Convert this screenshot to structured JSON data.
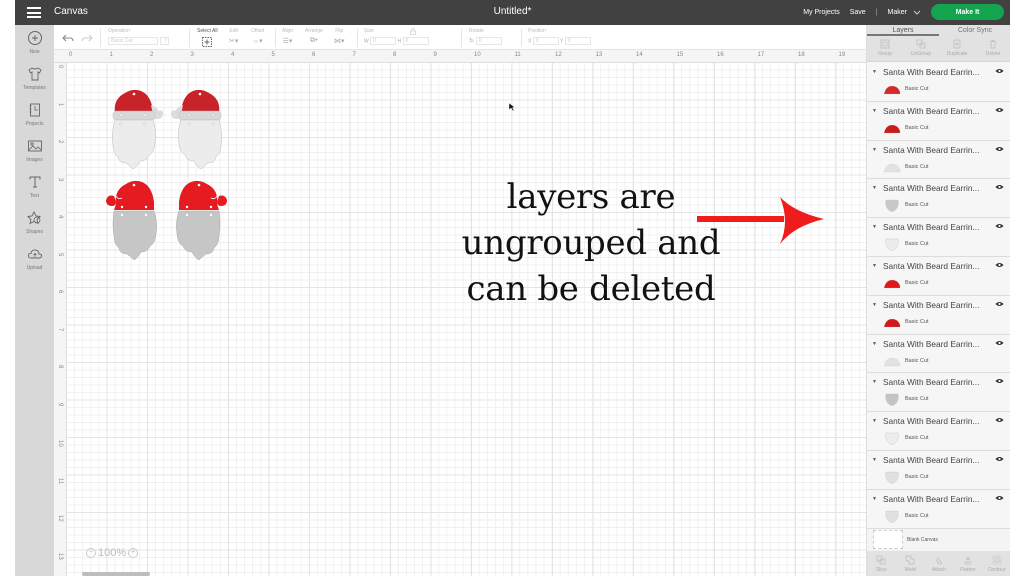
{
  "header": {
    "app_title": "Canvas",
    "document_title": "Untitled*",
    "links": [
      "My Projects",
      "Save"
    ],
    "machine": "Maker",
    "make_it": "Make It",
    "accent": "#14a44d"
  },
  "leftnav": {
    "items": [
      {
        "label": "New",
        "icon": "plus-circle-icon"
      },
      {
        "label": "Templates",
        "icon": "tshirt-icon"
      },
      {
        "label": "Projects",
        "icon": "notebook-icon"
      },
      {
        "label": "Images",
        "icon": "image-icon"
      },
      {
        "label": "Text",
        "icon": "text-icon"
      },
      {
        "label": "Shapes",
        "icon": "shapes-icon"
      },
      {
        "label": "Upload",
        "icon": "cloud-upload-icon"
      }
    ]
  },
  "toolbar": {
    "operation_label": "Operation",
    "operation_value": "Basic Cut",
    "help": "?",
    "select_all": "Select All",
    "edit": "Edit",
    "offset": "Offset",
    "align": "Align",
    "arrange": "Arrange",
    "flip": "Flip",
    "size": "Size",
    "w_label": "W",
    "h_label": "H",
    "rotate": "Rotate",
    "position": "Position",
    "x_label": "X",
    "y_label": "Y",
    "w_value": "0",
    "h_value": "0",
    "rotate_value": "0",
    "x_value": "0",
    "y_value": "0"
  },
  "rulers": {
    "horizontal": [
      "0",
      "1",
      "2",
      "3",
      "4",
      "5",
      "6",
      "7",
      "8",
      "9",
      "10",
      "11",
      "12",
      "13",
      "14",
      "15",
      "16",
      "17",
      "18",
      "19"
    ],
    "vertical": [
      "0",
      "1",
      "2",
      "3",
      "4",
      "5",
      "6",
      "7",
      "8",
      "9",
      "10",
      "11",
      "12",
      "13"
    ]
  },
  "canvas": {
    "annotation_lines": [
      "layers are",
      "ungrouped and",
      "can be deleted"
    ],
    "annotation_arrow_color": "#ee1c1c",
    "zoom_level": "100%"
  },
  "panel": {
    "tabs": [
      "Layers",
      "Color Sync"
    ],
    "actions": [
      "Group",
      "UnGroup",
      "Duplicate",
      "Delete"
    ],
    "layers": [
      {
        "name": "Santa With Beard Earrin...",
        "operation": "Basic Cut",
        "thumb": "hat",
        "color": "#d42a2a"
      },
      {
        "name": "Santa With Beard Earrin...",
        "operation": "Basic Cut",
        "thumb": "hat",
        "color": "#c81e1e"
      },
      {
        "name": "Santa With Beard Earrin...",
        "operation": "Basic Cut",
        "thumb": "hat",
        "color": "#e2e2e2"
      },
      {
        "name": "Santa With Beard Earrin...",
        "operation": "Basic Cut",
        "thumb": "beard",
        "color": "#c8c8c8"
      },
      {
        "name": "Santa With Beard Earrin...",
        "operation": "Basic Cut",
        "thumb": "beard",
        "color": "#ececec"
      },
      {
        "name": "Santa With Beard Earrin...",
        "operation": "Basic Cut",
        "thumb": "hat",
        "color": "#e01818"
      },
      {
        "name": "Santa With Beard Earrin...",
        "operation": "Basic Cut",
        "thumb": "hat",
        "color": "#d01a1a"
      },
      {
        "name": "Santa With Beard Earrin...",
        "operation": "Basic Cut",
        "thumb": "hat",
        "color": "#e2e2e2"
      },
      {
        "name": "Santa With Beard Earrin...",
        "operation": "Basic Cut",
        "thumb": "beard",
        "color": "#c4c4c4"
      },
      {
        "name": "Santa With Beard Earrin...",
        "operation": "Basic Cut",
        "thumb": "beard",
        "color": "#ececec"
      },
      {
        "name": "Santa With Beard Earrin...",
        "operation": "Basic Cut",
        "thumb": "beard",
        "color": "#e0e0e0"
      },
      {
        "name": "Santa With Beard Earrin...",
        "operation": "Basic Cut",
        "thumb": "beard",
        "color": "#e0e0e0"
      }
    ],
    "blank_canvas": "Blank Canvas",
    "bottom_actions": [
      "Slice",
      "Weld",
      "Attach",
      "Flatten",
      "Contour"
    ]
  }
}
